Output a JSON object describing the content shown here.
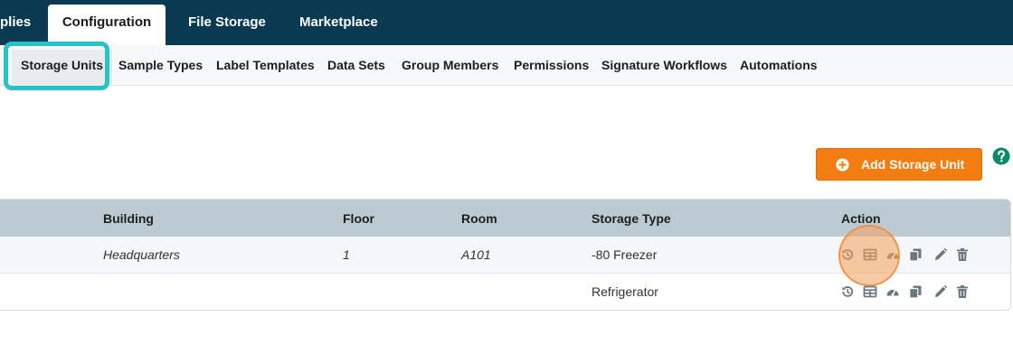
{
  "topnav": {
    "tabs": [
      {
        "label": "plies",
        "active": false
      },
      {
        "label": "Configuration",
        "active": true
      },
      {
        "label": "File Storage",
        "active": false
      },
      {
        "label": "Marketplace",
        "active": false
      }
    ]
  },
  "subnav": {
    "tabs": [
      {
        "label": "Storage Units",
        "active": true
      },
      {
        "label": "Sample Types"
      },
      {
        "label": "Label Templates"
      },
      {
        "label": "Data Sets"
      },
      {
        "label": "Group Members"
      },
      {
        "label": "Permissions"
      },
      {
        "label": "Signature Workflows"
      },
      {
        "label": "Automations"
      }
    ]
  },
  "toolbar": {
    "add_label": "Add Storage Unit",
    "help_icon": "question-circle-icon"
  },
  "table": {
    "headers": {
      "building": "Building",
      "floor": "Floor",
      "room": "Room",
      "storage_type": "Storage Type",
      "action": "Action"
    },
    "rows": [
      {
        "building": "Headquarters",
        "floor": "1",
        "room": "A101",
        "storage_type": "-80 Freezer"
      },
      {
        "building": "",
        "floor": "",
        "room": "",
        "storage_type": "Refrigerator"
      }
    ],
    "action_icons": [
      "history-icon",
      "grid-icon",
      "gauge-icon",
      "copy-icon",
      "edit-icon",
      "trash-icon"
    ]
  },
  "colors": {
    "nav_bg": "#0a3a52",
    "accent_orange": "#f47d12",
    "highlight_teal": "#27c3c8",
    "icon_gray": "#6b7780",
    "help_green": "#0a8a6c"
  }
}
